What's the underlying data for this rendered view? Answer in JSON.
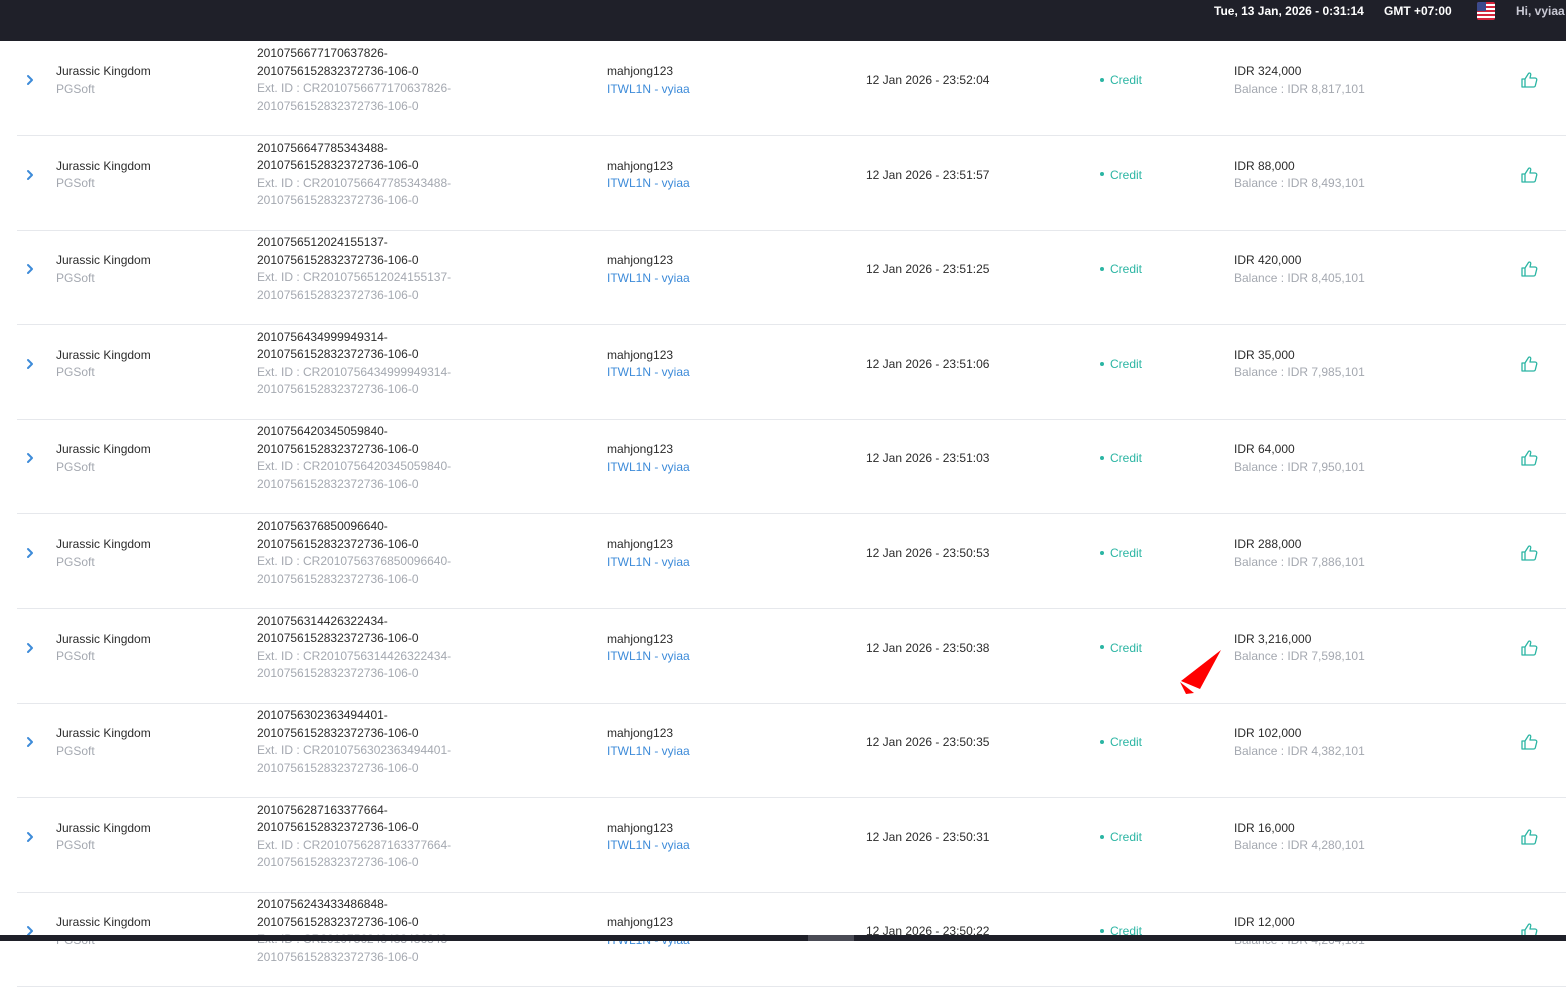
{
  "header": {
    "datetime": "Tue, 13 Jan, 2026 - 0:31:14",
    "timezone": "GMT +07:00",
    "greeting": "Hi, vyiaa"
  },
  "colors": {
    "credit": "#2bb5a3",
    "link": "#3d8bd9",
    "accent": "#3d8bd9",
    "arrow": "#ff0000"
  },
  "rows": [
    {
      "game": "Jurassic Kingdom",
      "provider": "PGSoft",
      "tx1": "2010756677170637826-",
      "tx2": "2010756152832372736-106-0",
      "ext1": "Ext. ID : CR2010756677170637826-",
      "ext2": "2010756152832372736-106-0",
      "player": "mahjong123",
      "agent": "ITWL1N - vyiaa",
      "date": "12 Jan 2026 - 23:52:04",
      "status": "Credit",
      "amount": "IDR 324,000",
      "balance": "Balance : IDR 8,817,101"
    },
    {
      "game": "Jurassic Kingdom",
      "provider": "PGSoft",
      "tx1": "2010756647785343488-",
      "tx2": "2010756152832372736-106-0",
      "ext1": "Ext. ID : CR2010756647785343488-",
      "ext2": "2010756152832372736-106-0",
      "player": "mahjong123",
      "agent": "ITWL1N - vyiaa",
      "date": "12 Jan 2026 - 23:51:57",
      "status": "Credit",
      "amount": "IDR 88,000",
      "balance": "Balance : IDR 8,493,101"
    },
    {
      "game": "Jurassic Kingdom",
      "provider": "PGSoft",
      "tx1": "2010756512024155137-",
      "tx2": "2010756152832372736-106-0",
      "ext1": "Ext. ID : CR2010756512024155137-",
      "ext2": "2010756152832372736-106-0",
      "player": "mahjong123",
      "agent": "ITWL1N - vyiaa",
      "date": "12 Jan 2026 - 23:51:25",
      "status": "Credit",
      "amount": "IDR 420,000",
      "balance": "Balance : IDR 8,405,101"
    },
    {
      "game": "Jurassic Kingdom",
      "provider": "PGSoft",
      "tx1": "2010756434999949314-",
      "tx2": "2010756152832372736-106-0",
      "ext1": "Ext. ID : CR2010756434999949314-",
      "ext2": "2010756152832372736-106-0",
      "player": "mahjong123",
      "agent": "ITWL1N - vyiaa",
      "date": "12 Jan 2026 - 23:51:06",
      "status": "Credit",
      "amount": "IDR 35,000",
      "balance": "Balance : IDR 7,985,101"
    },
    {
      "game": "Jurassic Kingdom",
      "provider": "PGSoft",
      "tx1": "2010756420345059840-",
      "tx2": "2010756152832372736-106-0",
      "ext1": "Ext. ID : CR2010756420345059840-",
      "ext2": "2010756152832372736-106-0",
      "player": "mahjong123",
      "agent": "ITWL1N - vyiaa",
      "date": "12 Jan 2026 - 23:51:03",
      "status": "Credit",
      "amount": "IDR 64,000",
      "balance": "Balance : IDR 7,950,101"
    },
    {
      "game": "Jurassic Kingdom",
      "provider": "PGSoft",
      "tx1": "2010756376850096640-",
      "tx2": "2010756152832372736-106-0",
      "ext1": "Ext. ID : CR2010756376850096640-",
      "ext2": "2010756152832372736-106-0",
      "player": "mahjong123",
      "agent": "ITWL1N - vyiaa",
      "date": "12 Jan 2026 - 23:50:53",
      "status": "Credit",
      "amount": "IDR 288,000",
      "balance": "Balance : IDR 7,886,101"
    },
    {
      "game": "Jurassic Kingdom",
      "provider": "PGSoft",
      "tx1": "2010756314426322434-",
      "tx2": "2010756152832372736-106-0",
      "ext1": "Ext. ID : CR2010756314426322434-",
      "ext2": "2010756152832372736-106-0",
      "player": "mahjong123",
      "agent": "ITWL1N - vyiaa",
      "date": "12 Jan 2026 - 23:50:38",
      "status": "Credit",
      "amount": "IDR 3,216,000",
      "balance": "Balance : IDR 7,598,101"
    },
    {
      "game": "Jurassic Kingdom",
      "provider": "PGSoft",
      "tx1": "2010756302363494401-",
      "tx2": "2010756152832372736-106-0",
      "ext1": "Ext. ID : CR2010756302363494401-",
      "ext2": "2010756152832372736-106-0",
      "player": "mahjong123",
      "agent": "ITWL1N - vyiaa",
      "date": "12 Jan 2026 - 23:50:35",
      "status": "Credit",
      "amount": "IDR 102,000",
      "balance": "Balance : IDR 4,382,101"
    },
    {
      "game": "Jurassic Kingdom",
      "provider": "PGSoft",
      "tx1": "2010756287163377664-",
      "tx2": "2010756152832372736-106-0",
      "ext1": "Ext. ID : CR2010756287163377664-",
      "ext2": "2010756152832372736-106-0",
      "player": "mahjong123",
      "agent": "ITWL1N - vyiaa",
      "date": "12 Jan 2026 - 23:50:31",
      "status": "Credit",
      "amount": "IDR 16,000",
      "balance": "Balance : IDR 4,280,101"
    },
    {
      "game": "Jurassic Kingdom",
      "provider": "PGSoft",
      "tx1": "2010756243433486848-",
      "tx2": "2010756152832372736-106-0",
      "ext1": "Ext. ID : CR2010756243433486848-",
      "ext2": "2010756152832372736-106-0",
      "player": "mahjong123",
      "agent": "ITWL1N - vyiaa",
      "date": "12 Jan 2026 - 23:50:22",
      "status": "Credit",
      "amount": "IDR 12,000",
      "balance": "Balance : IDR 4,264,101"
    }
  ]
}
